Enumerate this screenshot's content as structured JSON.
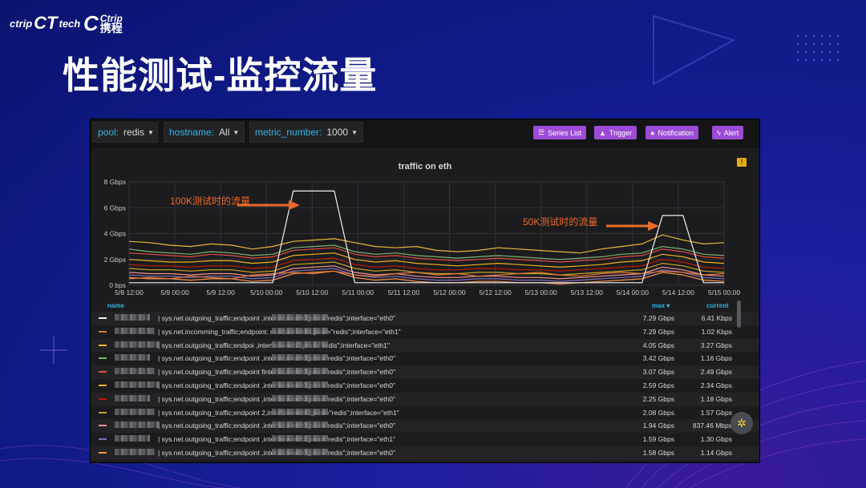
{
  "brand": {
    "tech_logo": "ctrip",
    "tech_logo_ct": "CT",
    "tech_logo_suffix": "tech",
    "company_en": "Ctrip",
    "company_cn": "携程"
  },
  "slide_title": "性能测试-监控流量",
  "dashboard": {
    "variables": [
      {
        "key": "pool:",
        "value": "redis"
      },
      {
        "key": "hostname:",
        "value": "All"
      },
      {
        "key": "metric_number:",
        "value": "1000"
      }
    ],
    "buttons": [
      {
        "label": "Series List",
        "icon": "list-icon"
      },
      {
        "label": "Trigger",
        "icon": "warning-icon"
      },
      {
        "label": "Notification",
        "icon": "bell-icon"
      },
      {
        "label": "Alert",
        "icon": "bolt-icon"
      }
    ],
    "accent": "#9b4bd6"
  },
  "annotations": {
    "a100k": "100K测试时的流量",
    "a50k": "50K测试时的流量"
  },
  "chart_data": {
    "type": "line",
    "title": "traffic on eth",
    "y_ticks": [
      "8 Gbps",
      "6 Gbps",
      "4 Gbps",
      "2 Gbps",
      "0 bps"
    ],
    "ylim": [
      0,
      8
    ],
    "x_ticks": [
      "5/8 12:00",
      "5/9 00:00",
      "5/9 12:00",
      "5/10 00:00",
      "5/10 12:00",
      "5/11 00:00",
      "5/11 12:00",
      "5/12 00:00",
      "5/12 12:00",
      "5/13 00:00",
      "5/13 12:00",
      "5/14 00:00",
      "5/14 12:00",
      "5/15 00:00"
    ],
    "grid": true,
    "series": [
      {
        "color": "#f0f0f0",
        "max": "7.29 Gbps",
        "current": "6.41 Kbps",
        "row": "| sys.net.outgoing_traffic;endpoint ,interface=eth0;pool=\"redis\";interface=\"eth0\"",
        "values": [
          0.2,
          0.2,
          0.2,
          0.2,
          0.2,
          0.2,
          0.2,
          0.2,
          7.29,
          7.29,
          7.29,
          0.2,
          0.2,
          0.2,
          0.2,
          0.2,
          0.2,
          0.2,
          0.2,
          0.2,
          0.2,
          0.2,
          0.2,
          0.2,
          0.2,
          0.2,
          5.4,
          5.4,
          0.2,
          0.2
        ]
      },
      {
        "color": "#e07a3a",
        "max": "7.29 Gbps",
        "current": "1.02 Kbps",
        "row": "| sys.net.incomming_traffic;endpoint: nterface=eth1;pool=\"redis\";interface=\"eth1\"",
        "values": [
          0.5,
          0.6,
          0.5,
          0.7,
          0.6,
          0.5,
          0.8,
          0.9,
          1.0,
          0.9,
          1.1,
          0.8,
          0.7,
          0.9,
          1.0,
          0.8,
          0.9,
          0.7,
          0.8,
          0.9,
          1.0,
          0.8,
          0.7,
          0.9,
          1.0,
          0.9,
          1.1,
          1.0,
          0.8,
          0.9
        ]
      },
      {
        "color": "#eab839",
        "max": "4.05 Gbps",
        "current": "3.27 Gbps",
        "row": "| sys.net.outgoing_traffic;endpoi ,interface=eth1;pool=\"redis\";interface=\"eth1\"",
        "values": [
          3.4,
          3.3,
          3.1,
          3.0,
          3.2,
          3.1,
          2.8,
          3.0,
          3.4,
          3.5,
          3.6,
          3.3,
          3.0,
          2.9,
          3.0,
          2.7,
          2.6,
          2.7,
          2.9,
          2.8,
          2.7,
          2.6,
          2.5,
          2.8,
          3.0,
          3.2,
          3.9,
          3.5,
          3.2,
          3.3
        ]
      },
      {
        "color": "#7eb26d",
        "max": "3.42 Gbps",
        "current": "1.16 Gbps",
        "row": "| sys.net.outgoing_traffic;endpoint ,interface=eth0;pool=\"redis\";interface=\"eth0\"",
        "values": [
          2.8,
          2.6,
          2.5,
          2.4,
          2.6,
          2.5,
          2.3,
          2.4,
          2.9,
          3.0,
          3.1,
          2.6,
          2.4,
          2.5,
          2.3,
          2.2,
          2.1,
          2.2,
          2.3,
          2.2,
          2.1,
          2.0,
          2.1,
          2.2,
          2.4,
          2.5,
          3.0,
          2.8,
          2.4,
          2.3
        ]
      },
      {
        "color": "#e24d42",
        "max": "3.07 Gbps",
        "current": "2.49 Gbps",
        "row": "| sys.net.outgoing_traffic;endpoint finterface=eth0;pool=\"redis\";interface=\"eth0\"",
        "values": [
          2.5,
          2.4,
          2.3,
          2.2,
          2.4,
          2.3,
          2.1,
          2.2,
          2.7,
          2.8,
          2.9,
          2.4,
          2.2,
          2.3,
          2.1,
          2.0,
          1.9,
          2.0,
          2.1,
          2.0,
          1.9,
          1.8,
          1.9,
          2.0,
          2.2,
          2.3,
          2.8,
          2.6,
          2.2,
          2.1
        ]
      },
      {
        "color": "#efb020",
        "max": "2.59 Gbps",
        "current": "2.34 Gbps",
        "row": "| sys.net.outgoing_traffic;endpoint ,interface=eth0;pool=\"redis\";interface=\"eth0\"",
        "values": [
          2.0,
          1.9,
          1.8,
          1.8,
          1.9,
          1.9,
          1.7,
          1.8,
          2.3,
          2.4,
          2.5,
          2.0,
          1.8,
          1.9,
          1.7,
          1.6,
          1.5,
          1.6,
          1.7,
          1.6,
          1.5,
          1.4,
          1.5,
          1.6,
          1.8,
          1.9,
          2.4,
          2.2,
          1.8,
          1.7
        ]
      },
      {
        "color": "#bf1b00",
        "max": "2.25 Gbps",
        "current": "1.18 Gbps",
        "row": "| sys.net.outgoing_traffic;endpoint ,interface=eth0;pool=\"redis\";interface=\"eth0\"",
        "values": [
          1.6,
          1.5,
          1.5,
          1.4,
          1.5,
          1.5,
          1.3,
          1.4,
          1.9,
          2.0,
          2.1,
          1.6,
          1.4,
          1.5,
          1.3,
          1.2,
          1.2,
          1.3,
          1.3,
          1.2,
          1.2,
          1.1,
          1.2,
          1.3,
          1.4,
          1.5,
          2.0,
          1.8,
          1.4,
          1.3
        ]
      },
      {
        "color": "#c9a227",
        "max": "2.08 Gbps",
        "current": "1.57 Gbps",
        "row": "| sys.net.outgoing_traffic;endpoint 2,interface=eth1;pool=\"redis\";interface=\"eth1\"",
        "values": [
          1.3,
          1.2,
          1.2,
          1.1,
          1.2,
          1.2,
          1.0,
          1.1,
          1.6,
          1.7,
          1.8,
          1.3,
          1.1,
          1.2,
          1.0,
          0.9,
          0.9,
          1.0,
          1.0,
          0.9,
          0.9,
          0.8,
          0.9,
          1.0,
          1.1,
          1.2,
          1.7,
          1.5,
          1.1,
          1.0
        ]
      },
      {
        "color": "#f29191",
        "max": "1.94 Gbps",
        "current": "837.46 Mbps",
        "row": "| sys.net.outgoing_traffic;endpoint ,interface=eth0;pool=\"redis\";interface=\"eth0\"",
        "values": [
          1.0,
          0.9,
          0.9,
          0.8,
          0.9,
          0.9,
          0.7,
          0.8,
          1.3,
          1.4,
          1.5,
          1.0,
          0.8,
          0.9,
          0.7,
          0.6,
          0.6,
          0.7,
          0.7,
          0.6,
          0.6,
          0.5,
          0.6,
          0.7,
          0.8,
          0.9,
          1.4,
          1.2,
          0.8,
          0.7
        ]
      },
      {
        "color": "#806eb7",
        "max": "1.59 Gbps",
        "current": "1.30 Gbps",
        "row": "| sys.net.outgoing_traffic;endpoint ,interface=eth1;pool=\"redis\";interface=\"eth1\"",
        "values": [
          0.8,
          0.7,
          0.7,
          0.6,
          0.7,
          0.7,
          0.5,
          0.6,
          1.1,
          1.2,
          1.3,
          0.8,
          0.6,
          0.7,
          0.5,
          0.4,
          0.4,
          0.5,
          0.5,
          0.4,
          0.4,
          0.3,
          0.4,
          0.5,
          0.6,
          0.7,
          1.2,
          1.0,
          0.6,
          0.5
        ]
      },
      {
        "color": "#f9934e",
        "max": "1.58 Gbps",
        "current": "1.14 Gbps",
        "row": "| sys.net.outgoing_traffic;endpoint ,interface=eth0;pool=\"redis\";interface=\"eth0\"",
        "values": [
          0.6,
          0.5,
          0.5,
          0.4,
          0.5,
          0.5,
          0.3,
          0.4,
          0.9,
          1.0,
          1.1,
          0.6,
          0.4,
          0.5,
          0.3,
          0.2,
          0.2,
          0.3,
          0.3,
          0.2,
          0.2,
          0.1,
          0.2,
          0.3,
          0.4,
          0.5,
          1.0,
          0.8,
          0.4,
          0.3
        ]
      }
    ],
    "legend_headers": {
      "name": "name",
      "max": "max",
      "current": "current"
    }
  }
}
